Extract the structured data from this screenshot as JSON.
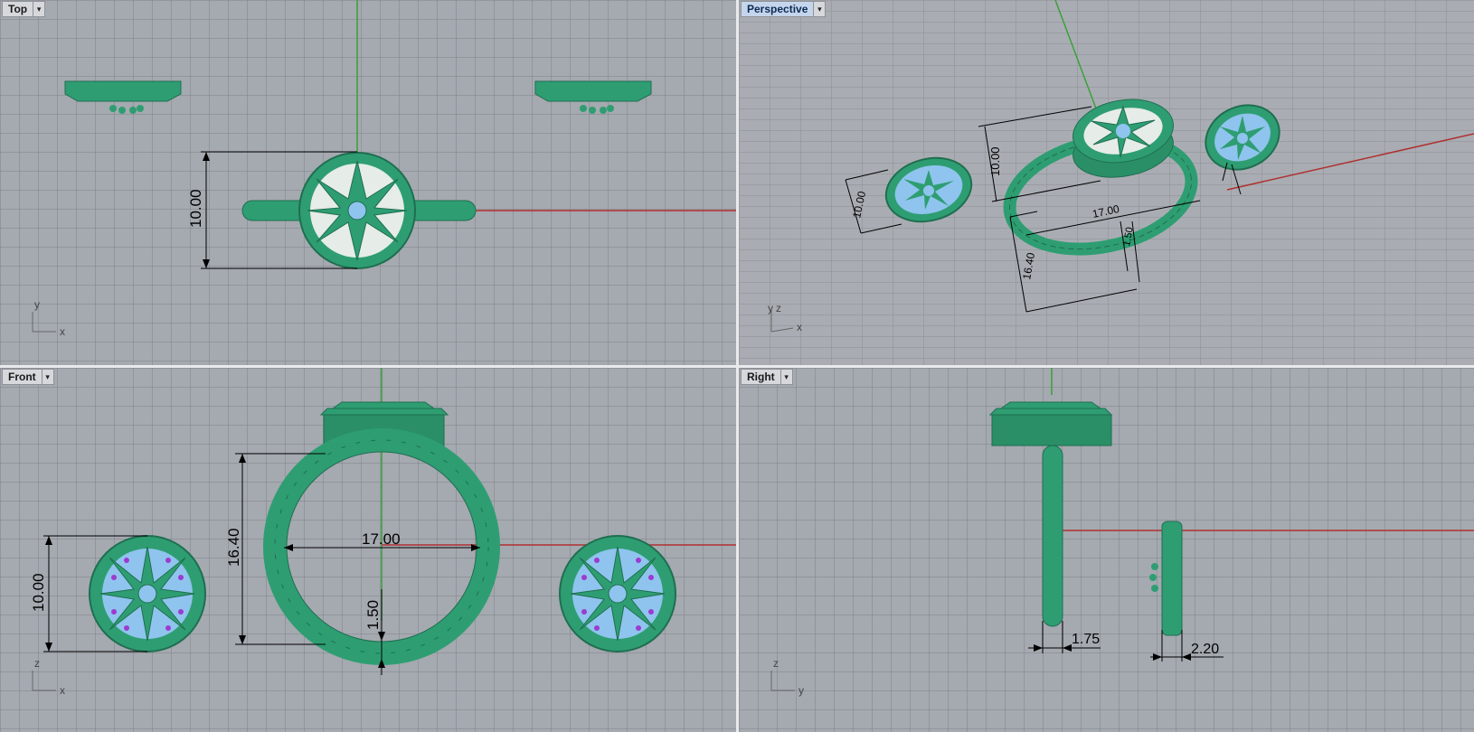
{
  "viewports": {
    "top": {
      "title": "Top",
      "dim_height": "10.00",
      "axis_a": "y",
      "axis_b": "x"
    },
    "perspective": {
      "title": "Perspective",
      "dim_a": "10.00",
      "dim_b": "10.00",
      "dim_c": "17.00",
      "dim_d": "1.50",
      "dim_e": "16.40",
      "axis_a": "y",
      "axis_b": "z",
      "axis_c": "x"
    },
    "front": {
      "title": "Front",
      "dim_head": "10.00",
      "dim_height": "16.40",
      "dim_width": "17.00",
      "dim_band": "1.50",
      "axis_a": "z",
      "axis_b": "x"
    },
    "right": {
      "title": "Right",
      "dim_band": "1.75",
      "dim_head": "2.20",
      "axis_a": "z",
      "axis_b": "y"
    }
  },
  "colors": {
    "metal": "#2e9e72",
    "metal_dark": "#1f6e50",
    "stone": "#8fc4ee",
    "gem": "#9c3bd0",
    "x_axis": "#b03030",
    "y_axis": "#3aa03a"
  }
}
